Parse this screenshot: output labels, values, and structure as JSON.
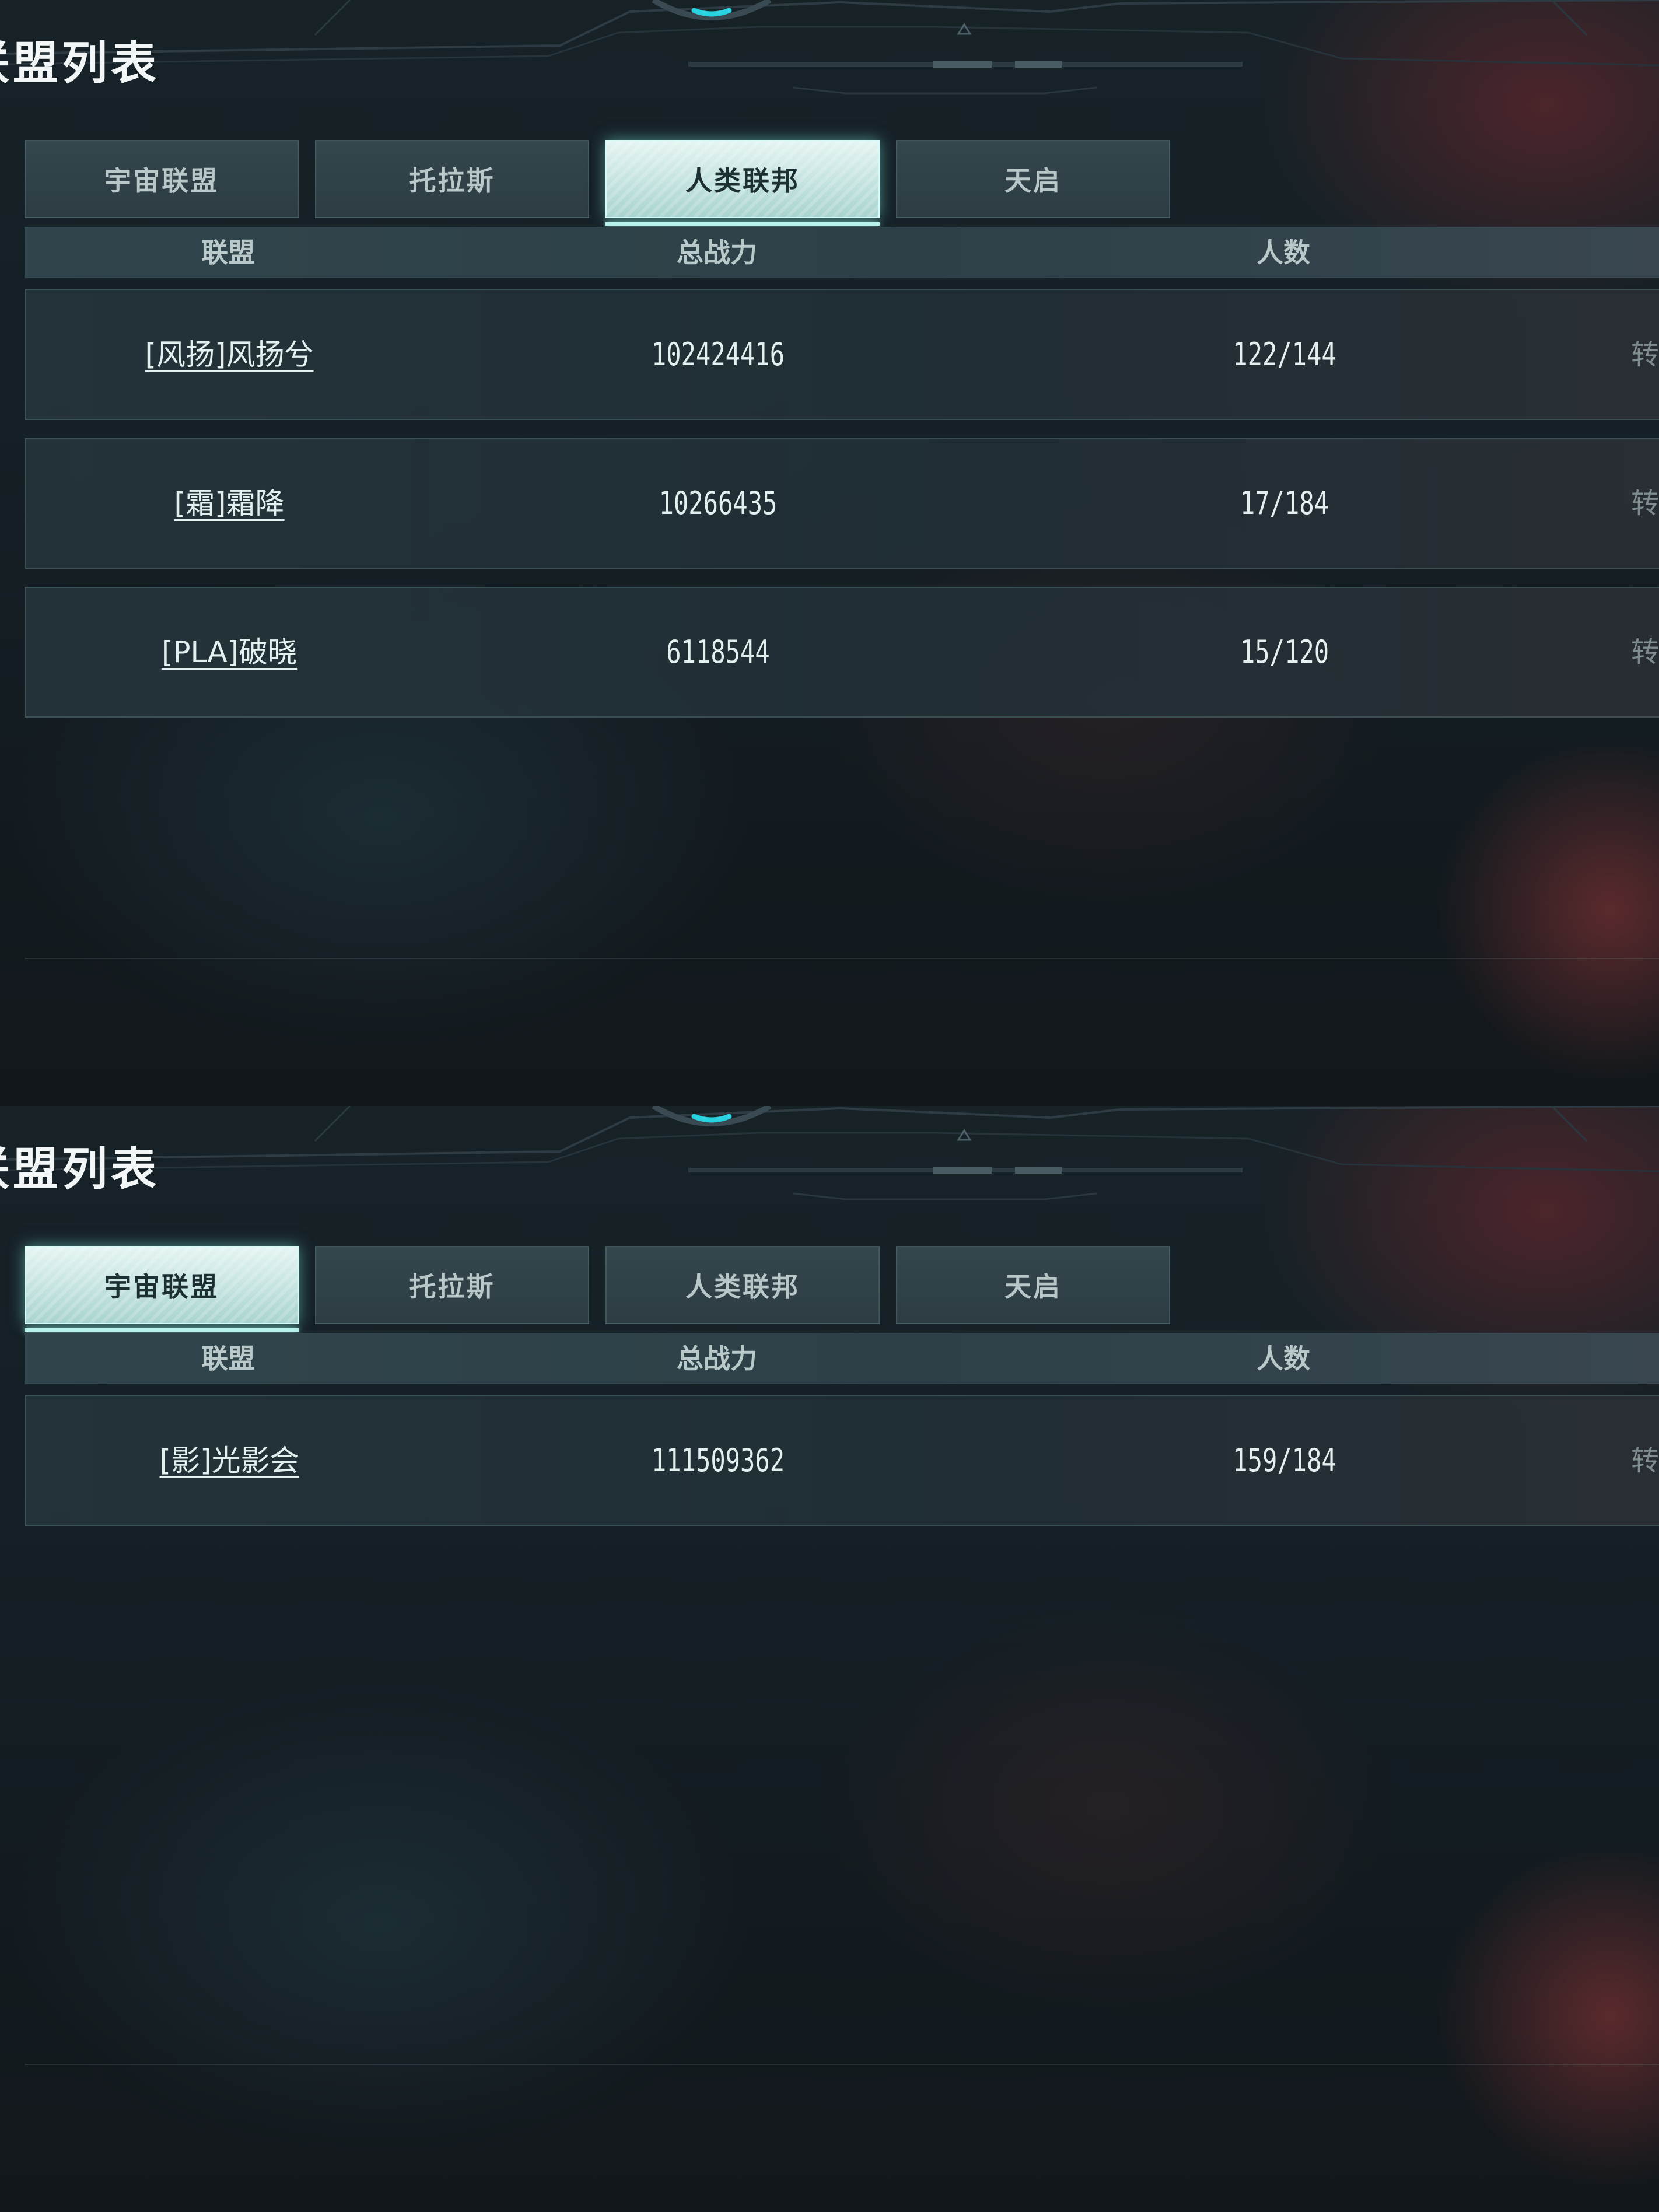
{
  "panels": [
    {
      "header": {
        "title": "联盟列表"
      },
      "tabs": [
        {
          "label": "宇宙联盟",
          "active": false
        },
        {
          "label": "托拉斯",
          "active": false
        },
        {
          "label": "人类联邦",
          "active": true
        },
        {
          "label": "天启",
          "active": false
        }
      ],
      "columns": {
        "alliance": "联盟",
        "power": "总战力",
        "members": "人数"
      },
      "rows": [
        {
          "name": "[风扬]风扬兮",
          "power": "102424416",
          "members": "122/144",
          "action": "转"
        },
        {
          "name": "[霜]霜降",
          "power": "10266435",
          "members": "17/184",
          "action": "转"
        },
        {
          "name": "[PLA]破晓",
          "power": "6118544",
          "members": "15/120",
          "action": "转"
        }
      ]
    },
    {
      "header": {
        "title": "联盟列表"
      },
      "tabs": [
        {
          "label": "宇宙联盟",
          "active": true
        },
        {
          "label": "托拉斯",
          "active": false
        },
        {
          "label": "人类联邦",
          "active": false
        },
        {
          "label": "天启",
          "active": false
        }
      ],
      "columns": {
        "alliance": "联盟",
        "power": "总战力",
        "members": "人数"
      },
      "rows": [
        {
          "name": "[影]光影会",
          "power": "111509362",
          "members": "159/184",
          "action": "转"
        }
      ]
    }
  ],
  "colors": {
    "accent": "#8fe6df",
    "active_tab": "#cfeeea",
    "tab": "#31434a",
    "text": "#e4f0ef"
  }
}
